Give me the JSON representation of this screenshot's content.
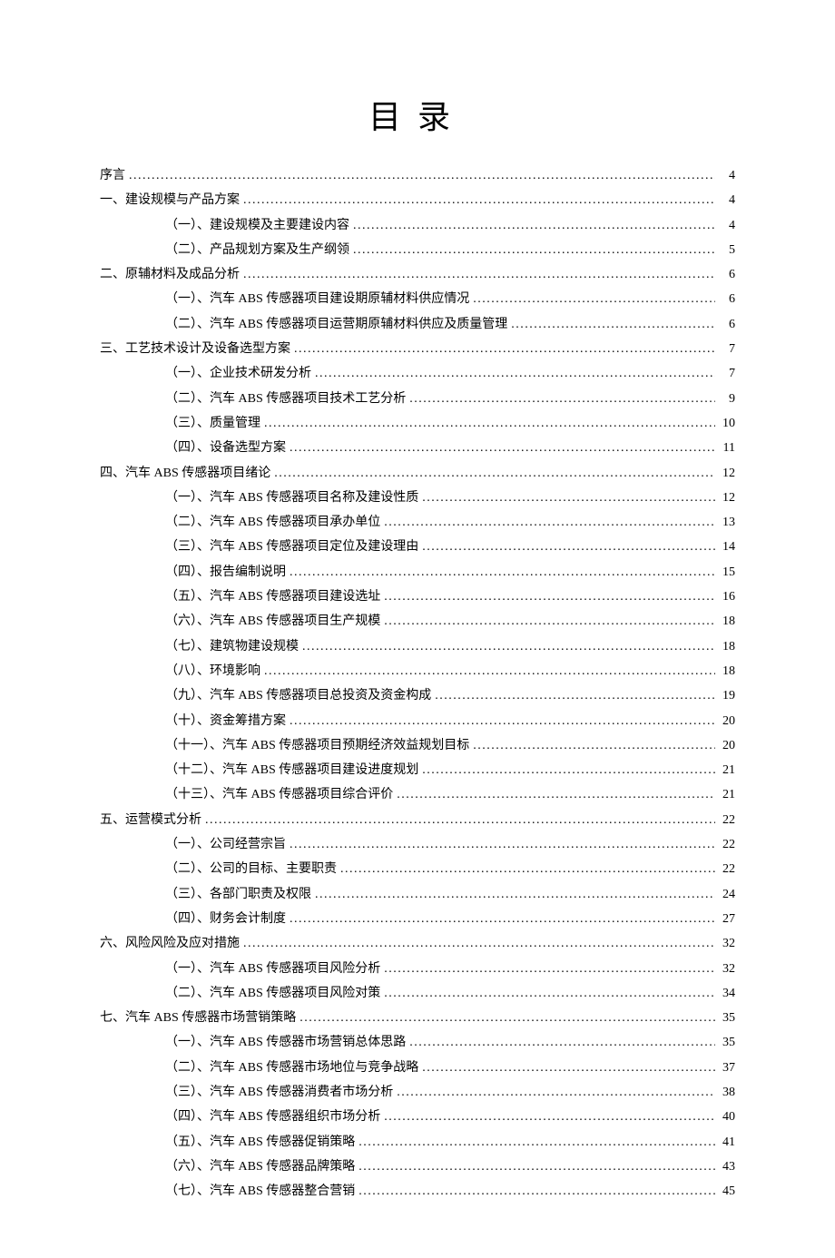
{
  "title": "目录",
  "entries": [
    {
      "level": 1,
      "label": "序言",
      "page": "4"
    },
    {
      "level": 1,
      "label": "一、建设规模与产品方案",
      "page": "4"
    },
    {
      "level": 2,
      "label": "（一）、建设规模及主要建设内容",
      "page": "4"
    },
    {
      "level": 2,
      "label": "（二）、产品规划方案及生产纲领",
      "page": "5"
    },
    {
      "level": 1,
      "label": "二、原辅材料及成品分析",
      "page": "6"
    },
    {
      "level": 2,
      "label": "（一）、汽车 ABS 传感器项目建设期原辅材料供应情况",
      "page": "6"
    },
    {
      "level": 2,
      "label": "（二）、汽车 ABS 传感器项目运营期原辅材料供应及质量管理",
      "page": "6"
    },
    {
      "level": 1,
      "label": "三、工艺技术设计及设备选型方案",
      "page": "7"
    },
    {
      "level": 2,
      "label": "（一）、企业技术研发分析",
      "page": "7"
    },
    {
      "level": 2,
      "label": "（二）、汽车 ABS 传感器项目技术工艺分析",
      "page": "9"
    },
    {
      "level": 2,
      "label": "（三）、质量管理",
      "page": "10"
    },
    {
      "level": 2,
      "label": "（四）、设备选型方案",
      "page": "11"
    },
    {
      "level": 1,
      "label": "四、汽车 ABS 传感器项目绪论",
      "page": "12"
    },
    {
      "level": 2,
      "label": "（一）、汽车 ABS 传感器项目名称及建设性质",
      "page": "12"
    },
    {
      "level": 2,
      "label": "（二）、汽车 ABS 传感器项目承办单位",
      "page": "13"
    },
    {
      "level": 2,
      "label": "（三）、汽车 ABS 传感器项目定位及建设理由",
      "page": "14"
    },
    {
      "level": 2,
      "label": "（四）、报告编制说明",
      "page": "15"
    },
    {
      "level": 2,
      "label": "（五）、汽车 ABS 传感器项目建设选址",
      "page": "16"
    },
    {
      "level": 2,
      "label": "（六）、汽车 ABS 传感器项目生产规模",
      "page": "18"
    },
    {
      "level": 2,
      "label": "（七）、建筑物建设规模",
      "page": "18"
    },
    {
      "level": 2,
      "label": "（八）、环境影响",
      "page": "18"
    },
    {
      "level": 2,
      "label": "（九）、汽车 ABS 传感器项目总投资及资金构成",
      "page": "19"
    },
    {
      "level": 2,
      "label": "（十）、资金筹措方案",
      "page": "20"
    },
    {
      "level": 2,
      "label": "（十一）、汽车 ABS 传感器项目预期经济效益规划目标",
      "page": "20"
    },
    {
      "level": 2,
      "label": "（十二）、汽车 ABS 传感器项目建设进度规划",
      "page": "21"
    },
    {
      "level": 2,
      "label": "（十三）、汽车 ABS 传感器项目综合评价",
      "page": "21"
    },
    {
      "level": 1,
      "label": "五、运营模式分析",
      "page": "22"
    },
    {
      "level": 2,
      "label": "（一）、公司经营宗旨",
      "page": "22"
    },
    {
      "level": 2,
      "label": "（二）、公司的目标、主要职责",
      "page": "22"
    },
    {
      "level": 2,
      "label": "（三）、各部门职责及权限",
      "page": "24"
    },
    {
      "level": 2,
      "label": "（四）、财务会计制度",
      "page": "27"
    },
    {
      "level": 1,
      "label": "六、风险风险及应对措施",
      "page": "32"
    },
    {
      "level": 2,
      "label": "（一）、汽车 ABS 传感器项目风险分析",
      "page": "32"
    },
    {
      "level": 2,
      "label": "（二）、汽车 ABS 传感器项目风险对策",
      "page": "34"
    },
    {
      "level": 1,
      "label": "七、汽车 ABS 传感器市场营销策略",
      "page": "35"
    },
    {
      "level": 2,
      "label": "（一）、汽车 ABS 传感器市场营销总体思路",
      "page": "35"
    },
    {
      "level": 2,
      "label": "（二）、汽车 ABS 传感器市场地位与竞争战略",
      "page": "37"
    },
    {
      "level": 2,
      "label": "（三）、汽车 ABS 传感器消费者市场分析",
      "page": "38"
    },
    {
      "level": 2,
      "label": "（四）、汽车 ABS 传感器组织市场分析",
      "page": "40"
    },
    {
      "level": 2,
      "label": "（五）、汽车 ABS 传感器促销策略",
      "page": "41"
    },
    {
      "level": 2,
      "label": "（六）、汽车 ABS 传感器品牌策略",
      "page": "43"
    },
    {
      "level": 2,
      "label": "（七）、汽车 ABS 传感器整合营销",
      "page": "45"
    }
  ]
}
